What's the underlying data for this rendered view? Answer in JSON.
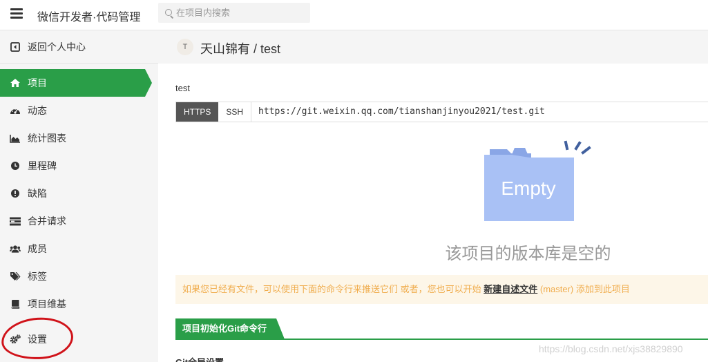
{
  "topbar": {
    "app_title": "微信开发者·代码管理",
    "search_placeholder": "在项目内搜索"
  },
  "sidebar": {
    "back_label": "返回个人中心",
    "items": [
      {
        "label": "项目",
        "icon": "home-icon",
        "active": true
      },
      {
        "label": "动态",
        "icon": "dashboard-icon",
        "active": false
      },
      {
        "label": "统计图表",
        "icon": "area-chart-icon",
        "active": false
      },
      {
        "label": "里程碑",
        "icon": "clock-icon",
        "active": false
      },
      {
        "label": "缺陷",
        "icon": "exclamation-icon",
        "active": false
      },
      {
        "label": "合并请求",
        "icon": "merge-icon",
        "active": false
      },
      {
        "label": "成员",
        "icon": "users-icon",
        "active": false
      },
      {
        "label": "标签",
        "icon": "tags-icon",
        "active": false
      },
      {
        "label": "项目维基",
        "icon": "book-icon",
        "active": false
      },
      {
        "label": "设置",
        "icon": "gears-icon",
        "active": false
      }
    ]
  },
  "header": {
    "avatar_letter": "T",
    "repo_path": "天山锦有 / test"
  },
  "main": {
    "repo_description": "test",
    "clone": {
      "protocols": [
        "HTTPS",
        "SSH"
      ],
      "selected": "HTTPS",
      "url": "https://git.weixin.qq.com/tianshanjinyou2021/test.git"
    },
    "empty": {
      "badge": "Empty",
      "message": "该项目的版本库是空的"
    },
    "notice": {
      "prefix": "如果您已经有文件，可以使用下面的命令行来推送它们 或者，您也可以开始 ",
      "link": "新建自述文件",
      "suffix": " (master) 添加到此项目"
    },
    "section_title": "项目初始化Git命令行",
    "sub_heading": "Git全局设置"
  },
  "watermark": "https://blog.csdn.net/xjs38829890",
  "colors": {
    "accent": "#2a9e48",
    "notice_text": "#f0ad4e",
    "notice_bg": "#fdf6e8",
    "folder": "#a9c1f5",
    "annotation": "#d0131a"
  }
}
